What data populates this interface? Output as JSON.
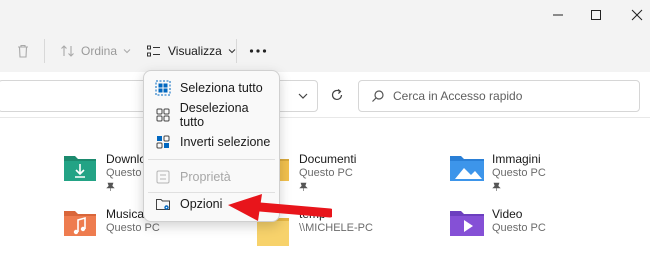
{
  "toolbar": {
    "sort_label": "Ordina",
    "view_label": "Visualizza"
  },
  "search": {
    "placeholder": "Cerca in Accesso rapido"
  },
  "menu": {
    "select_all": "Seleziona tutto",
    "deselect_all": "Deseleziona tutto",
    "invert_selection": "Inverti selezione",
    "properties": "Proprietà",
    "options": "Opzioni"
  },
  "folders": [
    {
      "name": "Download",
      "sub": "Questo PC",
      "icon": "downloads-folder-icon",
      "pinned": true
    },
    {
      "name": "Documenti",
      "sub": "Questo PC",
      "icon": "documents-folder-icon",
      "pinned": true
    },
    {
      "name": "Immagini",
      "sub": "Questo PC",
      "icon": "pictures-folder-icon",
      "pinned": true
    },
    {
      "name": "Musica",
      "sub": "Questo PC",
      "icon": "music-folder-icon",
      "pinned": false
    },
    {
      "name": "temp",
      "sub": "\\\\MICHELE-PC",
      "icon": "folder-icon",
      "pinned": false
    },
    {
      "name": "Video",
      "sub": "Questo PC",
      "icon": "videos-folder-icon",
      "pinned": false
    }
  ],
  "colors": {
    "accent": "#0067c0",
    "annotation_arrow": "#e8151b",
    "titlebar": "#f3f3f3"
  }
}
